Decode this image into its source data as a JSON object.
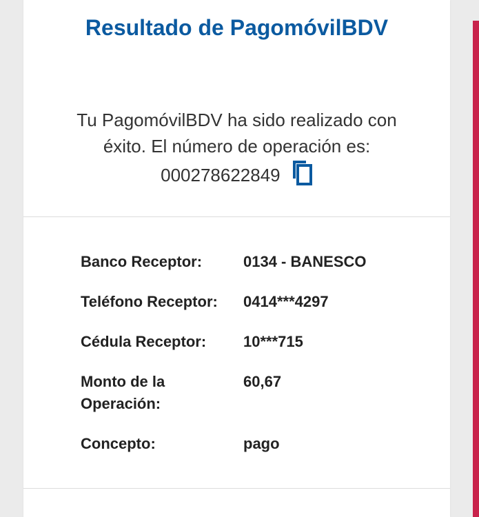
{
  "title": "Resultado de PagomóvilBDV",
  "message": {
    "line1": "Tu PagomóvilBDV ha sido realizado con",
    "line2": "éxito. El número de operación es:",
    "operation_number": "000278622849",
    "copy_icon": "copy-icon"
  },
  "details": [
    {
      "label": "Banco Receptor:",
      "value": "0134 - BANESCO"
    },
    {
      "label": "Teléfono Receptor:",
      "value": "0414***4297"
    },
    {
      "label": "Cédula Receptor:",
      "value": "10***715"
    },
    {
      "label": "Monto de la Operación:",
      "value": "60,67"
    },
    {
      "label": "Concepto:",
      "value": "pago"
    }
  ],
  "colors": {
    "title": "#0b5aa0",
    "icon": "#0b5aa0",
    "accent_bar": "#c8234b",
    "text": "#333333"
  }
}
